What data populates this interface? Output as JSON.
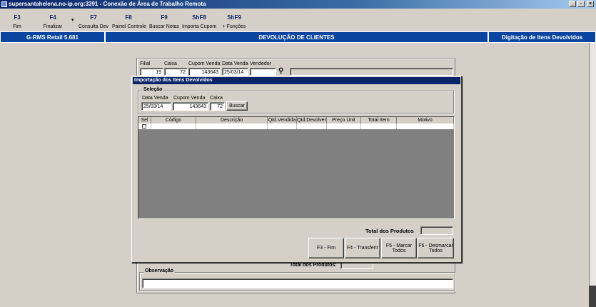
{
  "window": {
    "title": "supersantahelena.no-ip.org:3391 - Conexão de Área de Trabalho Remota",
    "min_glyph": "_",
    "restore_glyph": "▫",
    "close_glyph": "×"
  },
  "toolbar": [
    {
      "key": "F3",
      "label": "Fim"
    },
    {
      "key": "F4",
      "label": "Finalizar"
    },
    {
      "key": "F7",
      "label": "Consulta Dev"
    },
    {
      "key": "F8",
      "label": "Painel Controle"
    },
    {
      "key": "F9",
      "label": "Buscar Notas"
    },
    {
      "key": "ShF8",
      "label": "Importa Cupom"
    },
    {
      "key": "ShF9",
      "label": "+ Funções"
    }
  ],
  "toolbar_dropdown_glyph": "▾",
  "header": {
    "left": "G-RMS Retail 5.681",
    "center": "DEVOLUÇÃO DE CLIENTES",
    "right": "Digitação de Itens Devolvidos"
  },
  "background_form": {
    "labels": {
      "filial": "Filial",
      "caixa": "Caixa",
      "cupom": "Cupom Venda",
      "data": "Data Venda",
      "vendedor": "Vendedor"
    },
    "values": {
      "filial": "19",
      "caixa": "72",
      "cupom": "143643",
      "data": "25/03/14",
      "vendedor": ""
    },
    "binoculars_glyph": "⚲",
    "total_label": "Total dos Produtos:",
    "total_value": "",
    "observacao_title": "Observação",
    "observacao_value": ""
  },
  "dialog": {
    "title": "Importação dos Itens Devolvidos",
    "selecao_title": "Seleção",
    "labels": {
      "data": "Data Venda",
      "cupom": "Cupom Venda",
      "caixa": "Caixa"
    },
    "values": {
      "data": "25/03/14",
      "cupom": "143643",
      "caixa": "72"
    },
    "buscar_label": "Buscar",
    "columns": [
      "Sel",
      "Código",
      "Descrição",
      "Qtd.Vendida",
      "Qtd.Devolver",
      "Preço Unit",
      "Total Item",
      "Motivo"
    ],
    "total_label": "Total dos Produtos",
    "total_value": "",
    "buttons": {
      "fim": "F3 - Fim",
      "transferir": "F4 - Transferir",
      "marcar_1": "F5 - Marcar",
      "marcar_2": "Todos",
      "desmarcar_1": "F6 - Desmarcar",
      "desmarcar_2": "Todos"
    }
  }
}
